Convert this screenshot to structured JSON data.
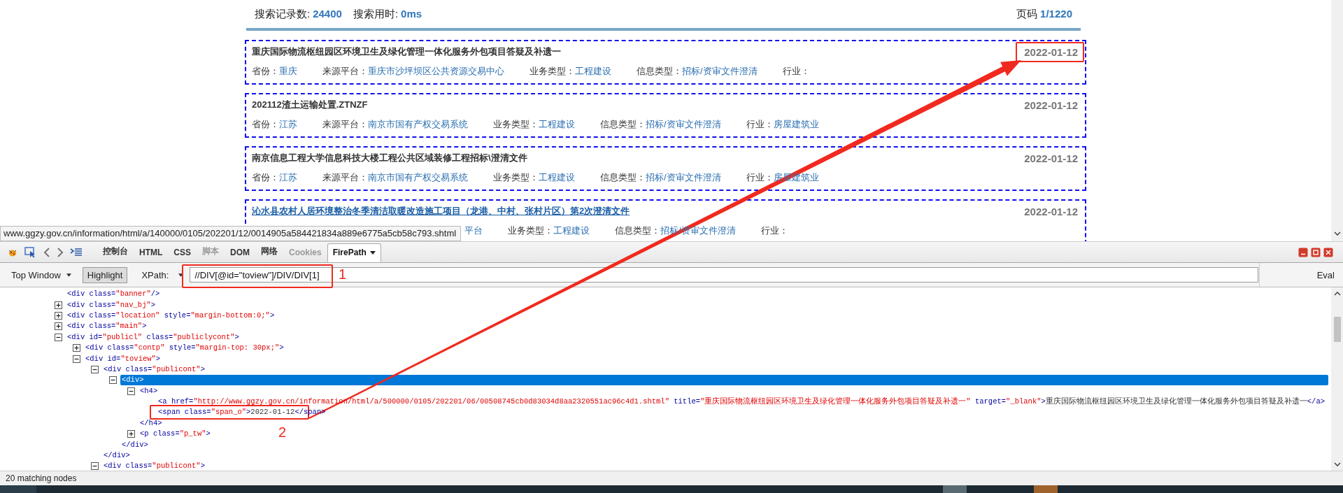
{
  "web_page": {
    "summary": {
      "count_label": "搜索记录数:",
      "count": "24400",
      "time_label": "搜索用时:",
      "time": "0ms",
      "page_label": "页码",
      "page": "1/1220"
    },
    "results": [
      {
        "title": "重庆国际物流枢纽园区环境卫生及绿化管理一体化服务外包项目答疑及补遗一",
        "hovered": false,
        "date": "2022-01-12",
        "meta": [
          {
            "kind": "field",
            "label": "省份：",
            "value": "重庆"
          },
          {
            "kind": "field",
            "label": "来源平台：",
            "value": "重庆市沙坪坝区公共资源交易中心"
          },
          {
            "kind": "field",
            "label": "业务类型：",
            "value": "工程建设"
          },
          {
            "kind": "field",
            "label": "信息类型：",
            "value": "招标/资审文件澄清"
          },
          {
            "kind": "field",
            "label": "行业："
          }
        ]
      },
      {
        "title": "202112渣土运输处置.ZTNZF",
        "hovered": false,
        "date": "2022-01-12",
        "meta": [
          {
            "kind": "field",
            "label": "省份：",
            "value": "江苏"
          },
          {
            "kind": "field",
            "label": "来源平台：",
            "value": "南京市国有产权交易系统"
          },
          {
            "kind": "field",
            "label": "业务类型：",
            "value": "工程建设"
          },
          {
            "kind": "field",
            "label": "信息类型：",
            "value": "招标/资审文件澄清"
          },
          {
            "kind": "field",
            "label": "行业：",
            "value": "房屋建筑业"
          }
        ]
      },
      {
        "title": "南京信息工程大学信息科技大楼工程公共区域装修工程招标\\澄清文件",
        "hovered": false,
        "date": "2022-01-12",
        "meta": [
          {
            "kind": "field",
            "label": "省份：",
            "value": "江苏"
          },
          {
            "kind": "field",
            "label": "来源平台：",
            "value": "南京市国有产权交易系统"
          },
          {
            "kind": "field",
            "label": "业务类型：",
            "value": "工程建设"
          },
          {
            "kind": "field",
            "label": "信息类型：",
            "value": "招标/资审文件澄清"
          },
          {
            "kind": "field",
            "label": "行业：",
            "value": "房屋建筑业"
          }
        ]
      },
      {
        "title": "沁水县农村人居环境整治冬季清洁取暖改造施工项目（龙港、中村、张村片区）第2次澄清文件",
        "hovered": true,
        "date": "2022-01-12",
        "meta": [
          {
            "kind": "fragment",
            "value": "平台"
          },
          {
            "kind": "field",
            "label": "业务类型：",
            "value": "工程建设"
          },
          {
            "kind": "field",
            "label": "信息类型：",
            "value": "招标/资审文件澄清"
          },
          {
            "kind": "field",
            "label": "行业："
          }
        ]
      }
    ]
  },
  "status_url": "www.ggzy.gov.cn/information/html/a/140000/0105/202201/12/0014905a584421834a889e6775a5cb58c793.shtml",
  "devtools": {
    "tabs": [
      {
        "label": "控制台",
        "selected": false,
        "disabled": false
      },
      {
        "label": "HTML",
        "selected": false,
        "disabled": false
      },
      {
        "label": "CSS",
        "selected": false,
        "disabled": false
      },
      {
        "label": "脚本",
        "selected": false,
        "disabled": true
      },
      {
        "label": "DOM",
        "selected": false,
        "disabled": false
      },
      {
        "label": "网络",
        "selected": false,
        "disabled": false
      },
      {
        "label": "Cookies",
        "selected": false,
        "disabled": true
      },
      {
        "label": "FirePath",
        "selected": true,
        "disabled": false
      }
    ],
    "frame_select": "Top Window",
    "highlight": {
      "label": "Highlight",
      "on": true
    },
    "xpath_label": "XPath:",
    "xpath": "//DIV[@id=\"toview\"]/DIV/DIV[1]",
    "eval": "Eval",
    "tree": [
      {
        "selected": false,
        "tokens": [
          {
            "t": "<div",
            "kind": "tag"
          },
          {
            "t": " class=",
            "kind": "attr"
          },
          {
            "t": "\"banner\"",
            "kind": "val"
          },
          {
            "t": "/>",
            "kind": "tag"
          }
        ]
      },
      {
        "expanded": false,
        "selected": false,
        "tokens": [
          {
            "t": "<div",
            "kind": "tag"
          },
          {
            "t": " class=",
            "kind": "attr"
          },
          {
            "t": "\"nav_bj\"",
            "kind": "val"
          },
          {
            "t": ">",
            "kind": "tag"
          }
        ]
      },
      {
        "expanded": false,
        "selected": false,
        "tokens": [
          {
            "t": "<div",
            "kind": "tag"
          },
          {
            "t": " class=",
            "kind": "attr"
          },
          {
            "t": "\"location\"",
            "kind": "val"
          },
          {
            "t": " style=",
            "kind": "attr"
          },
          {
            "t": "\"margin-bottom:0;\"",
            "kind": "val"
          },
          {
            "t": ">",
            "kind": "tag"
          }
        ]
      },
      {
        "expanded": false,
        "selected": false,
        "tokens": [
          {
            "t": "<div",
            "kind": "tag"
          },
          {
            "t": " class=",
            "kind": "attr"
          },
          {
            "t": "\"main\"",
            "kind": "val"
          },
          {
            "t": ">",
            "kind": "tag"
          }
        ]
      },
      {
        "expanded": true,
        "selected": false,
        "tokens": [
          {
            "t": "<div",
            "kind": "tag"
          },
          {
            "t": " id=",
            "kind": "attr"
          },
          {
            "t": "\"publicl\"",
            "kind": "val"
          },
          {
            "t": " class=",
            "kind": "attr"
          },
          {
            "t": "\"publiclycont\"",
            "kind": "val"
          },
          {
            "t": ">",
            "kind": "tag"
          }
        ],
        "children": [
          {
            "expanded": false,
            "selected": false,
            "tokens": [
              {
                "t": "<div",
                "kind": "tag"
              },
              {
                "t": " class=",
                "kind": "attr"
              },
              {
                "t": "\"contp\"",
                "kind": "val"
              },
              {
                "t": " style=",
                "kind": "attr"
              },
              {
                "t": "\"margin-top: 30px;\"",
                "kind": "val"
              },
              {
                "t": ">",
                "kind": "tag"
              }
            ]
          },
          {
            "expanded": true,
            "selected": false,
            "tokens": [
              {
                "t": "<div",
                "kind": "tag"
              },
              {
                "t": " id=",
                "kind": "attr"
              },
              {
                "t": "\"toview\"",
                "kind": "val"
              },
              {
                "t": ">",
                "kind": "tag"
              }
            ],
            "children": [
              {
                "expanded": true,
                "selected": false,
                "tokens": [
                  {
                    "t": "<div",
                    "kind": "tag"
                  },
                  {
                    "t": " class=",
                    "kind": "attr"
                  },
                  {
                    "t": "\"publicont\"",
                    "kind": "val"
                  },
                  {
                    "t": ">",
                    "kind": "tag"
                  }
                ],
                "children": [
                  {
                    "expanded": true,
                    "selected": true,
                    "tokens": [
                      {
                        "t": "<div>",
                        "kind": "tag"
                      }
                    ],
                    "children": [
                      {
                        "expanded": true,
                        "selected": false,
                        "tokens": [
                          {
                            "t": "<h4>",
                            "kind": "tag"
                          }
                        ],
                        "children": [
                          {
                            "selected": false,
                            "tokens": [
                              {
                                "t": "<a",
                                "kind": "tag"
                              },
                              {
                                "t": " href=",
                                "kind": "attr"
                              },
                              {
                                "t": "\"http://www.ggzy.gov.cn/information/html/a/500000/0105/202201/06/00508745cb0d83034d8aa2320551ac96c4d1.shtml\"",
                                "kind": "val"
                              },
                              {
                                "t": " title=",
                                "kind": "attr"
                              },
                              {
                                "t": "\"重庆国际物流枢纽园区环境卫生及绿化管理一体化服务外包项目答疑及补遗一\"",
                                "kind": "val"
                              },
                              {
                                "t": " target=",
                                "kind": "attr"
                              },
                              {
                                "t": "\"_blank\"",
                                "kind": "val"
                              },
                              {
                                "t": ">",
                                "kind": "tag"
                              },
                              {
                                "t": "重庆国际物流枢纽园区环境卫生及绿化管理一体化服务外包项目答疑及补遗一",
                                "kind": "text"
                              },
                              {
                                "t": "</a>",
                                "kind": "tag"
                              }
                            ]
                          },
                          {
                            "selected": false,
                            "tokens": [
                              {
                                "t": "<span",
                                "kind": "tag"
                              },
                              {
                                "t": " class=",
                                "kind": "attr"
                              },
                              {
                                "t": "\"span_o\"",
                                "kind": "val"
                              },
                              {
                                "t": ">",
                                "kind": "tag"
                              },
                              {
                                "t": "2022-01-12",
                                "kind": "text"
                              },
                              {
                                "t": "</span>",
                                "kind": "tag"
                              }
                            ]
                          }
                        ],
                        "close": [
                          {
                            "t": "</h4>",
                            "kind": "tag"
                          }
                        ]
                      },
                      {
                        "expanded": false,
                        "selected": false,
                        "tokens": [
                          {
                            "t": "<p",
                            "kind": "tag"
                          },
                          {
                            "t": " class=",
                            "kind": "attr"
                          },
                          {
                            "t": "\"p_tw\"",
                            "kind": "val"
                          },
                          {
                            "t": ">",
                            "kind": "tag"
                          }
                        ]
                      }
                    ],
                    "close": [
                      {
                        "t": "</div>",
                        "kind": "tag"
                      }
                    ]
                  }
                ],
                "close": [
                  {
                    "t": "</div>",
                    "kind": "tag"
                  }
                ]
              },
              {
                "expanded": true,
                "selected": false,
                "tokens": [
                  {
                    "t": "<div",
                    "kind": "tag"
                  },
                  {
                    "t": " class=",
                    "kind": "attr"
                  },
                  {
                    "t": "\"publicont\"",
                    "kind": "val"
                  },
                  {
                    "t": ">",
                    "kind": "tag"
                  }
                ]
              }
            ]
          }
        ]
      }
    ],
    "status": "20 matching nodes"
  },
  "annotations": [
    {
      "label": "1"
    },
    {
      "label": "2"
    }
  ]
}
